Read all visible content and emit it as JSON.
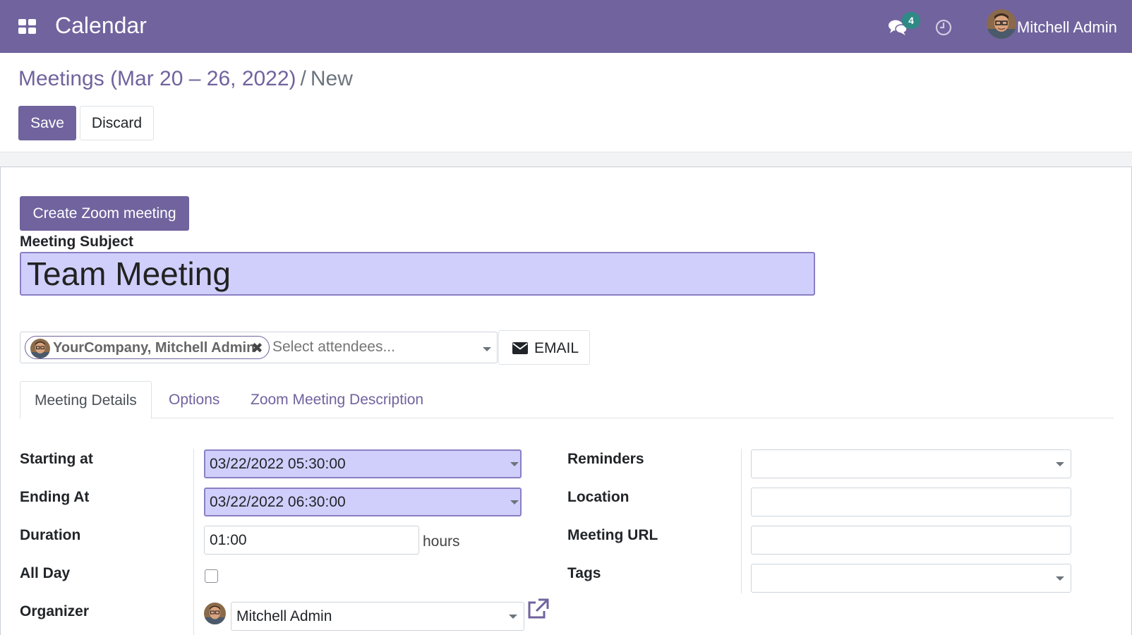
{
  "navbar": {
    "app_title": "Calendar",
    "messages_badge": "4",
    "user_name": "Mitchell Admin",
    "brand_color": "#71639e"
  },
  "breadcrumb": {
    "parent": "Meetings (Mar 20 – 26, 2022)",
    "separator": "/",
    "current": "New"
  },
  "actions": {
    "save_label": "Save",
    "discard_label": "Discard"
  },
  "form": {
    "zoom_button_label": "Create Zoom meeting",
    "subject_label": "Meeting Subject",
    "subject_value": "Team Meeting",
    "attendees": {
      "tags": [
        "YourCompany, Mitchell Admin"
      ],
      "remove_glyph": "✖",
      "placeholder": "Select attendees..."
    },
    "email_button_label": "EMAIL",
    "tabs": [
      "Meeting Details",
      "Options",
      "Zoom Meeting Description"
    ],
    "active_tab": "Meeting Details",
    "left_fields": {
      "start": {
        "label": "Starting at",
        "value": "03/22/2022 05:30:00"
      },
      "stop": {
        "label": "Ending At",
        "value": "03/22/2022 06:30:00"
      },
      "duration": {
        "label": "Duration",
        "value": "01:00",
        "unit": "hours"
      },
      "allday": {
        "label": "All Day",
        "checked": false
      },
      "organizer": {
        "label": "Organizer",
        "value": "Mitchell Admin"
      }
    },
    "right_fields": {
      "reminders": {
        "label": "Reminders",
        "value": ""
      },
      "location": {
        "label": "Location",
        "value": ""
      },
      "meeting_url": {
        "label": "Meeting URL",
        "value": ""
      },
      "tags": {
        "label": "Tags",
        "value": ""
      }
    }
  },
  "icons": {
    "apps": "apps-grid-icon",
    "chat": "chat-bubbles-icon",
    "clock": "clock-icon",
    "envelope": "envelope-icon",
    "external": "external-link-icon"
  }
}
